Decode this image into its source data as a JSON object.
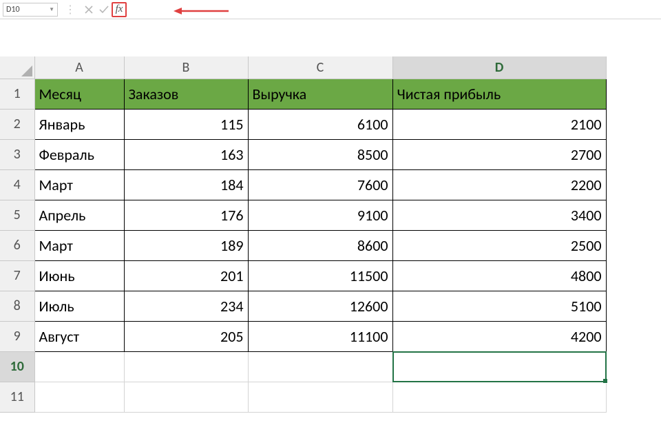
{
  "nameBox": {
    "value": "D10"
  },
  "fxButton": {
    "label": "fx"
  },
  "columns": [
    "A",
    "B",
    "C",
    "D"
  ],
  "selectedColumn": "D",
  "rowNumbers": [
    "1",
    "2",
    "3",
    "4",
    "5",
    "6",
    "7",
    "8",
    "9",
    "10",
    "11"
  ],
  "selectedRow": "10",
  "headers": {
    "A": "Месяц",
    "B": "Заказов",
    "C": "Выручка",
    "D": "Чистая прибыль"
  },
  "rows": [
    {
      "month": "Январь",
      "orders": "115",
      "revenue": "6100",
      "profit": "2100"
    },
    {
      "month": "Февраль",
      "orders": "163",
      "revenue": "8500",
      "profit": "2700"
    },
    {
      "month": "Март",
      "orders": "184",
      "revenue": "7600",
      "profit": "2200"
    },
    {
      "month": "Апрель",
      "orders": "176",
      "revenue": "9100",
      "profit": "3400"
    },
    {
      "month": "Март",
      "orders": "189",
      "revenue": "8600",
      "profit": "2500"
    },
    {
      "month": "Июнь",
      "orders": "201",
      "revenue": "11500",
      "profit": "4800"
    },
    {
      "month": "Июль",
      "orders": "234",
      "revenue": "12600",
      "profit": "5100"
    },
    {
      "month": "Август",
      "orders": "205",
      "revenue": "11100",
      "profit": "4200"
    }
  ],
  "activeCell": "D10",
  "chart_data": {
    "type": "table",
    "title": "",
    "columns": [
      "Месяц",
      "Заказов",
      "Выручка",
      "Чистая прибыль"
    ],
    "data": [
      [
        "Январь",
        115,
        6100,
        2100
      ],
      [
        "Февраль",
        163,
        8500,
        2700
      ],
      [
        "Март",
        184,
        7600,
        2200
      ],
      [
        "Апрель",
        176,
        9100,
        3400
      ],
      [
        "Март",
        189,
        8600,
        2500
      ],
      [
        "Июнь",
        201,
        11500,
        4800
      ],
      [
        "Июль",
        234,
        12600,
        5100
      ],
      [
        "Август",
        205,
        11100,
        4200
      ]
    ]
  }
}
